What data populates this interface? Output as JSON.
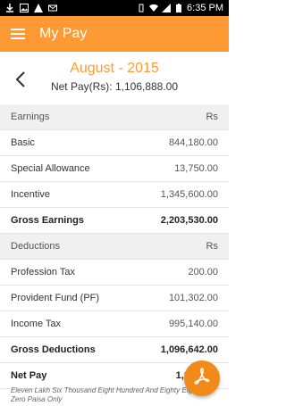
{
  "status_bar": {
    "time": "6:35 PM"
  },
  "appbar": {
    "title": "My Pay"
  },
  "header": {
    "month": "August - 2015",
    "net_pay": "Net Pay(Rs): 1,106,888.00"
  },
  "earnings": {
    "header_label": "Earnings",
    "currency": "Rs",
    "rows": [
      {
        "label": "Basic",
        "value": "844,180.00"
      },
      {
        "label": "Special Allowance",
        "value": "13,750.00"
      },
      {
        "label": "Incentive",
        "value": "1,345,600.00"
      }
    ],
    "gross_label": "Gross Earnings",
    "gross_value": "2,203,530.00"
  },
  "deductions": {
    "header_label": "Deductions",
    "currency": "Rs",
    "rows": [
      {
        "label": "Profession Tax",
        "value": "200.00"
      },
      {
        "label": "Provident Fund (PF)",
        "value": "101,302.00"
      },
      {
        "label": "Income Tax",
        "value": "995,140.00"
      }
    ],
    "gross_label": "Gross Deductions",
    "gross_value": "1,096,642.00"
  },
  "net_pay_row": {
    "label": "Net Pay",
    "value": "1,10"
  },
  "amount_in_words": "Eleven Lakh Six Thousand Eight Hundred And Eighty Eight And Zero Paisa Only",
  "colors": {
    "accent": "#ff9933",
    "fab": "#f28a1a"
  },
  "icons": {
    "menu": "hamburger-menu-icon",
    "back": "chevron-left-icon",
    "fab": "pdf-icon"
  }
}
